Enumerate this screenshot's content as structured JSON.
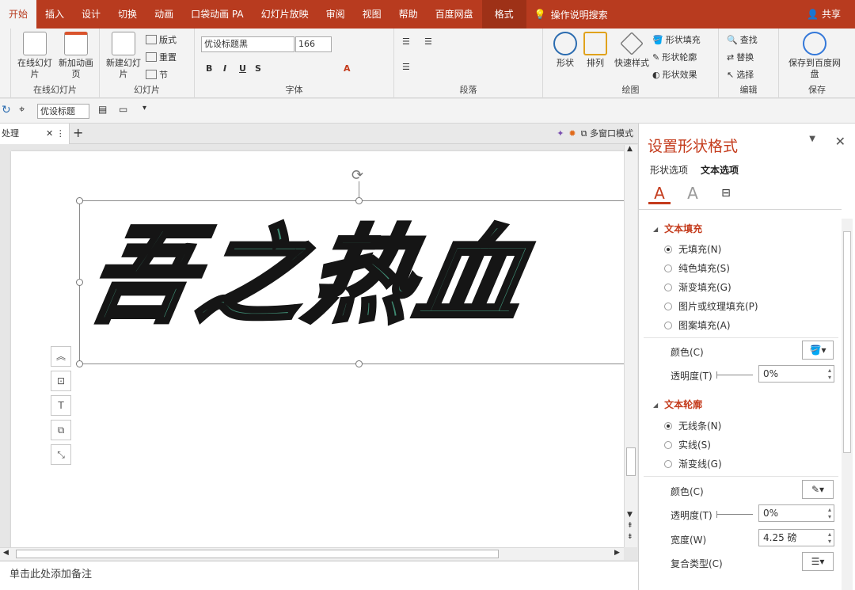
{
  "ribbon": {
    "tabs": [
      "开始",
      "插入",
      "设计",
      "切换",
      "动画",
      "口袋动画 PA",
      "幻灯片放映",
      "审阅",
      "视图",
      "帮助",
      "百度网盘",
      "格式"
    ],
    "tell_me": "操作说明搜索",
    "share": "共享",
    "groups": {
      "online_slides": {
        "label": "在线幻灯片",
        "btn1": "在线幻灯片",
        "btn2": "新加动画页"
      },
      "slides": {
        "label": "幻灯片",
        "new_slide": "新建幻灯片",
        "layout": "版式",
        "reset": "重置",
        "section": "节"
      },
      "font": {
        "label": "字体",
        "font_name": "优设标题黑",
        "font_size": "166"
      },
      "paragraph": {
        "label": "段落"
      },
      "drawing": {
        "label": "绘图",
        "shapes": "形状",
        "arrange": "排列",
        "quick_styles": "快速样式",
        "fill": "形状填充",
        "outline": "形状轮廓",
        "effects": "形状效果"
      },
      "editing": {
        "label": "编辑",
        "find": "查找",
        "replace": "替换",
        "select": "选择"
      },
      "save": {
        "label": "保存",
        "save_btn": "保存到百度网盘"
      }
    }
  },
  "qat": {
    "font": "优设标题"
  },
  "doc": {
    "tab": "处理",
    "multiwindow": "多窗口模式"
  },
  "slide": {
    "wordart": "吾之热血"
  },
  "notes": "单击此处添加备注",
  "pane": {
    "title": "设置形状格式",
    "tabs": [
      "形状选项",
      "文本选项"
    ],
    "fill": {
      "title": "文本填充",
      "options": [
        "无填充(N)",
        "纯色填充(S)",
        "渐变填充(G)",
        "图片或纹理填充(P)",
        "图案填充(A)"
      ],
      "color_label": "颜色(C)",
      "transparency_label": "透明度(T)",
      "transparency": "0%"
    },
    "outline": {
      "title": "文本轮廓",
      "options": [
        "无线条(N)",
        "实线(S)",
        "渐变线(G)"
      ],
      "color_label": "颜色(C)",
      "transparency_label": "透明度(T)",
      "transparency": "0%",
      "width_label": "宽度(W)",
      "width": "4.25 磅",
      "compound_label": "复合类型(C)"
    }
  }
}
